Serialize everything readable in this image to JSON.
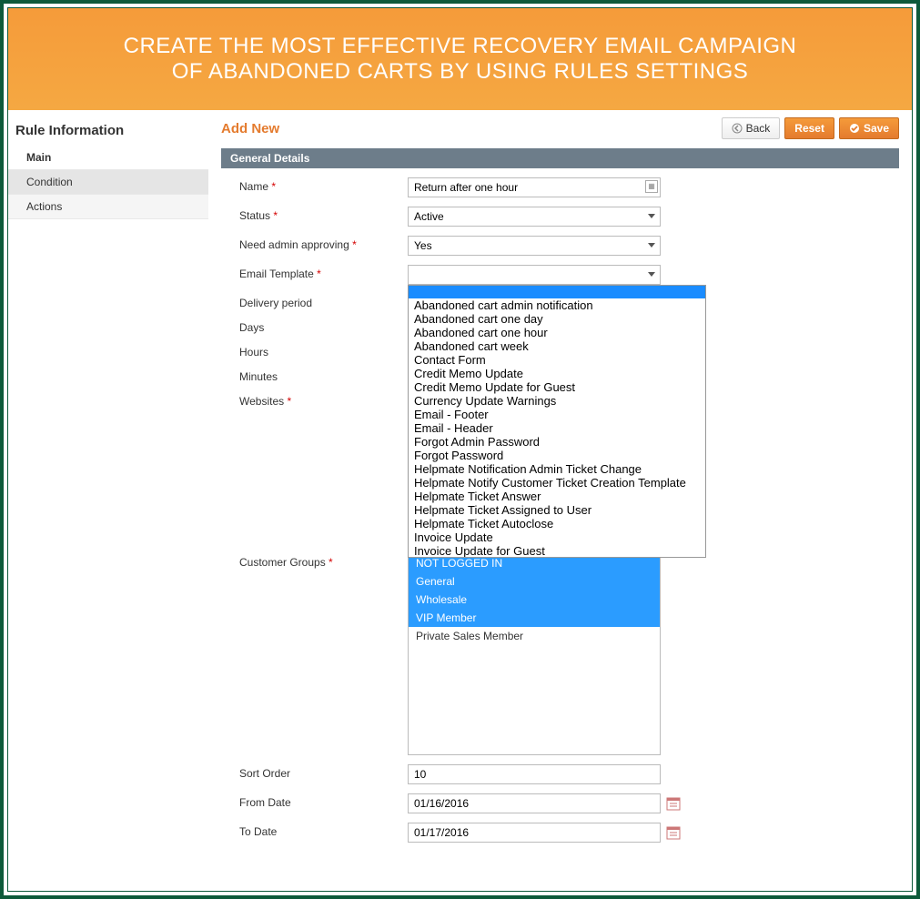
{
  "banner": {
    "line1": "CREATE THE MOST EFFECTIVE RECOVERY EMAIL CAMPAIGN",
    "line2": "OF ABANDONED CARTS BY USING RULES SETTINGS"
  },
  "sidebar": {
    "title": "Rule Information",
    "items": [
      "Main",
      "Condition",
      "Actions"
    ]
  },
  "page_title": "Add New",
  "buttons": {
    "back": "Back",
    "reset": "Reset",
    "save": "Save"
  },
  "section": "General Details",
  "form": {
    "name": {
      "label": "Name",
      "value": "Return after one hour"
    },
    "status": {
      "label": "Status",
      "value": "Active"
    },
    "need_admin": {
      "label": "Need admin approving",
      "value": "Yes"
    },
    "email_template": {
      "label": "Email Template",
      "value": ""
    },
    "delivery_period": {
      "label": "Delivery period"
    },
    "days": {
      "label": "Days"
    },
    "hours": {
      "label": "Hours"
    },
    "minutes": {
      "label": "Minutes"
    },
    "websites": {
      "label": "Websites"
    },
    "customer_groups": {
      "label": "Customer Groups"
    },
    "sort_order": {
      "label": "Sort Order",
      "value": "10"
    },
    "from_date": {
      "label": "From Date",
      "value": "01/16/2016"
    },
    "to_date": {
      "label": "To Date",
      "value": "01/17/2016"
    }
  },
  "template_options": [
    "",
    "Abandoned cart admin notification",
    "Abandoned cart one day",
    "Abandoned cart one hour",
    "Abandoned cart week",
    "Contact Form",
    "Credit Memo Update",
    "Credit Memo Update for Guest",
    "Currency Update Warnings",
    "Email - Footer",
    "Email - Header",
    "Forgot Admin Password",
    "Forgot Password",
    "Helpmate Notification Admin Ticket Change",
    "Helpmate Notify Customer Ticket Creation Template",
    "Helpmate Ticket Answer",
    "Helpmate Ticket Assigned to User",
    "Helpmate Ticket Autoclose",
    "Invoice Update",
    "Invoice Update for Guest"
  ],
  "customer_group_options": [
    {
      "label": "NOT LOGGED IN",
      "selected": true
    },
    {
      "label": "General",
      "selected": true
    },
    {
      "label": "Wholesale",
      "selected": true
    },
    {
      "label": "VIP Member",
      "selected": true
    },
    {
      "label": "Private Sales Member",
      "selected": false
    }
  ]
}
